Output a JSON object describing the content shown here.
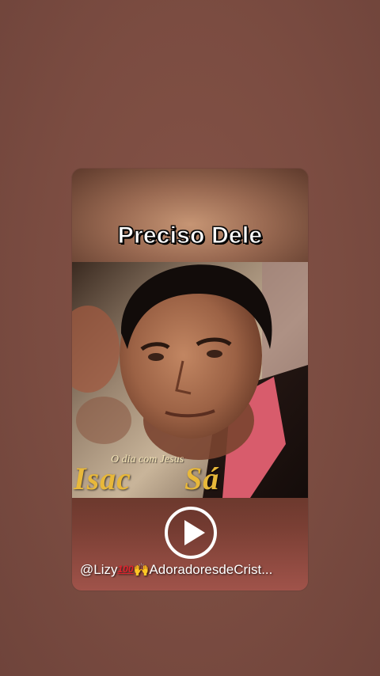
{
  "post": {
    "title": "Preciso Dele",
    "credit_handle": "@Lizy",
    "credit_emoji_100": "100",
    "credit_emoji_hands": "🙌",
    "credit_channel": "AdoradoresdeCrist..."
  },
  "album": {
    "subtitle": "O dia com Jesus",
    "artist_first": "Isac",
    "artist_last": "Sá"
  },
  "controls": {
    "play_icon": "play-icon"
  },
  "colors": {
    "background": "#7a4a40",
    "accent_gold": "#e8b83a",
    "title_text": "#ffffff"
  }
}
